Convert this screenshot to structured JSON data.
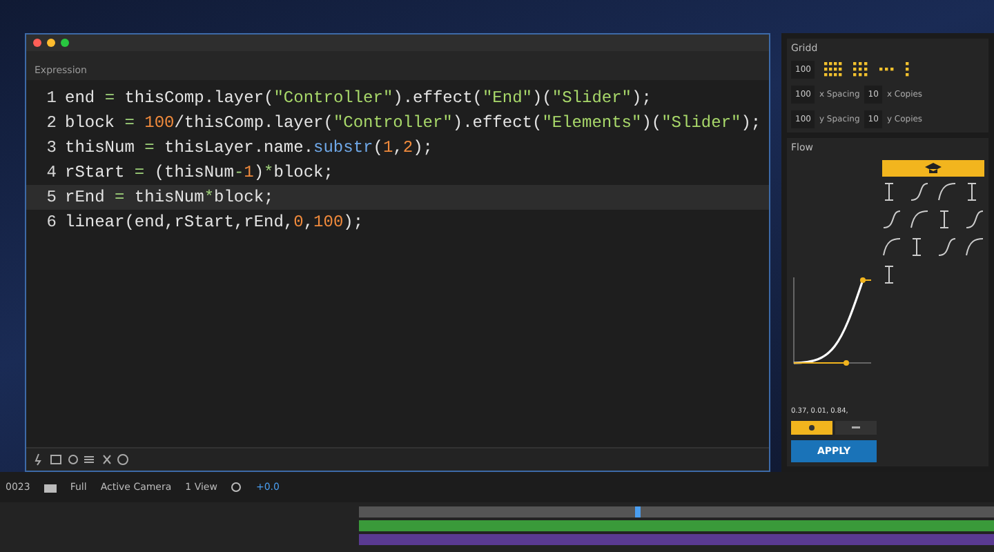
{
  "editor": {
    "title": "Expression",
    "lines": [
      {
        "number": "1",
        "selected": false,
        "tokens": [
          {
            "kind": "plain",
            "text": "end "
          },
          {
            "kind": "op",
            "text": "="
          },
          {
            "kind": "plain",
            "text": " thisComp.layer("
          },
          {
            "kind": "str",
            "text": "\"Controller\""
          },
          {
            "kind": "plain",
            "text": ").effect("
          },
          {
            "kind": "str",
            "text": "\"End\""
          },
          {
            "kind": "plain",
            "text": ")("
          },
          {
            "kind": "str",
            "text": "\"Slider\""
          },
          {
            "kind": "plain",
            "text": ");"
          }
        ]
      },
      {
        "number": "2",
        "selected": false,
        "tokens": [
          {
            "kind": "plain",
            "text": "block "
          },
          {
            "kind": "op",
            "text": "= "
          },
          {
            "kind": "num",
            "text": "100"
          },
          {
            "kind": "plain",
            "text": "/thisComp.layer("
          },
          {
            "kind": "str",
            "text": "\"Controller\""
          },
          {
            "kind": "plain",
            "text": ").effect("
          },
          {
            "kind": "str",
            "text": "\"Elements\""
          },
          {
            "kind": "plain",
            "text": ")("
          },
          {
            "kind": "str",
            "text": "\"Slider\""
          },
          {
            "kind": "plain",
            "text": ");"
          }
        ]
      },
      {
        "number": "3",
        "selected": false,
        "tokens": [
          {
            "kind": "plain",
            "text": "thisNum "
          },
          {
            "kind": "op",
            "text": "="
          },
          {
            "kind": "plain",
            "text": " thisLayer.name."
          },
          {
            "kind": "fn",
            "text": "substr"
          },
          {
            "kind": "plain",
            "text": "("
          },
          {
            "kind": "num",
            "text": "1"
          },
          {
            "kind": "plain",
            "text": ","
          },
          {
            "kind": "num",
            "text": "2"
          },
          {
            "kind": "plain",
            "text": ");"
          }
        ]
      },
      {
        "number": "4",
        "selected": false,
        "tokens": [
          {
            "kind": "plain",
            "text": "rStart "
          },
          {
            "kind": "op",
            "text": "="
          },
          {
            "kind": "plain",
            "text": " (thisNum"
          },
          {
            "kind": "op",
            "text": "-"
          },
          {
            "kind": "num",
            "text": "1"
          },
          {
            "kind": "plain",
            "text": ")"
          },
          {
            "kind": "op",
            "text": "*"
          },
          {
            "kind": "plain",
            "text": "block;"
          }
        ]
      },
      {
        "number": "5",
        "selected": true,
        "tokens": [
          {
            "kind": "plain",
            "text": "rEnd "
          },
          {
            "kind": "op",
            "text": "="
          },
          {
            "kind": "plain",
            "text": " thisNum"
          },
          {
            "kind": "op",
            "text": "*"
          },
          {
            "kind": "plain",
            "text": "block;"
          }
        ]
      },
      {
        "number": "6",
        "selected": false,
        "tokens": [
          {
            "kind": "plain",
            "text": "linear(end,rStart,rEnd,"
          },
          {
            "kind": "num",
            "text": "0"
          },
          {
            "kind": "plain",
            "text": ","
          },
          {
            "kind": "num",
            "text": "100"
          },
          {
            "kind": "plain",
            "text": ");"
          }
        ]
      }
    ]
  },
  "grid_panel": {
    "title": "Gridd",
    "size": "100",
    "x_spacing": "100",
    "x_spacing_label": "x Spacing",
    "x_copies": "10",
    "x_copies_label": "x Copies",
    "y_spacing": "100",
    "y_spacing_label": "y Spacing",
    "y_copies": "10",
    "y_copies_label": "y Copies"
  },
  "flow_panel": {
    "title": "Flow",
    "readout": "0.37, 0.01, 0.84,",
    "apply": "APPLY"
  },
  "viewer_bar": {
    "timecode": "0023",
    "resolution": "Full",
    "camera": "Active Camera",
    "views": "1 View",
    "exposure": "+0.0"
  }
}
